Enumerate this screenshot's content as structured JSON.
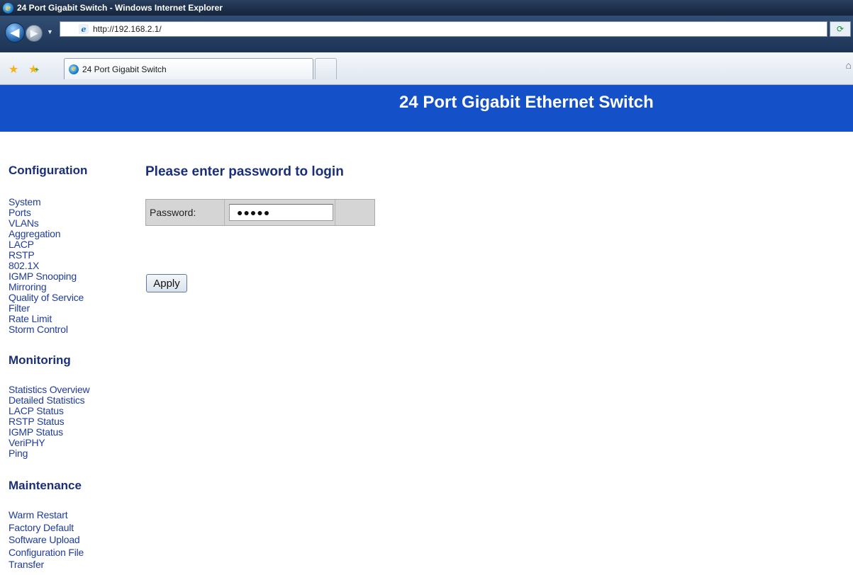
{
  "window": {
    "title": "24 Port Gigabit Switch - Windows Internet Explorer"
  },
  "address_bar": {
    "url": "http://192.168.2.1/"
  },
  "tabs": [
    {
      "label": "24 Port Gigabit Switch",
      "active": true
    }
  ],
  "banner": {
    "title": "24 Port Gigabit Ethernet Switch",
    "color": "#1450c8"
  },
  "sidebar": {
    "configuration": {
      "title": "Configuration",
      "items": [
        "System",
        "Ports",
        "VLANs",
        "Aggregation",
        "LACP",
        "RSTP",
        "802.1X",
        "IGMP Snooping",
        "Mirroring",
        "Quality of Service",
        "Filter",
        "Rate Limit",
        "Storm Control"
      ]
    },
    "monitoring": {
      "title": "Monitoring",
      "items": [
        "Statistics Overview",
        "Detailed Statistics",
        "LACP Status",
        "RSTP Status",
        "IGMP Status",
        "VeriPHY",
        "Ping"
      ]
    },
    "maintenance": {
      "title": "Maintenance",
      "items": [
        "Warm Restart",
        "Factory Default",
        "Software Upload",
        "Configuration File",
        "Transfer"
      ]
    }
  },
  "login": {
    "heading": "Please enter password to login",
    "password_label": "Password:",
    "password_value": "●●●●●",
    "apply_label": "Apply"
  },
  "icons": {
    "back": "back-arrow-icon",
    "forward": "forward-arrow-icon",
    "refresh": "refresh-icon",
    "favorites": "star-icon",
    "add_favorite": "add-favorite-icon",
    "home": "home-icon"
  }
}
